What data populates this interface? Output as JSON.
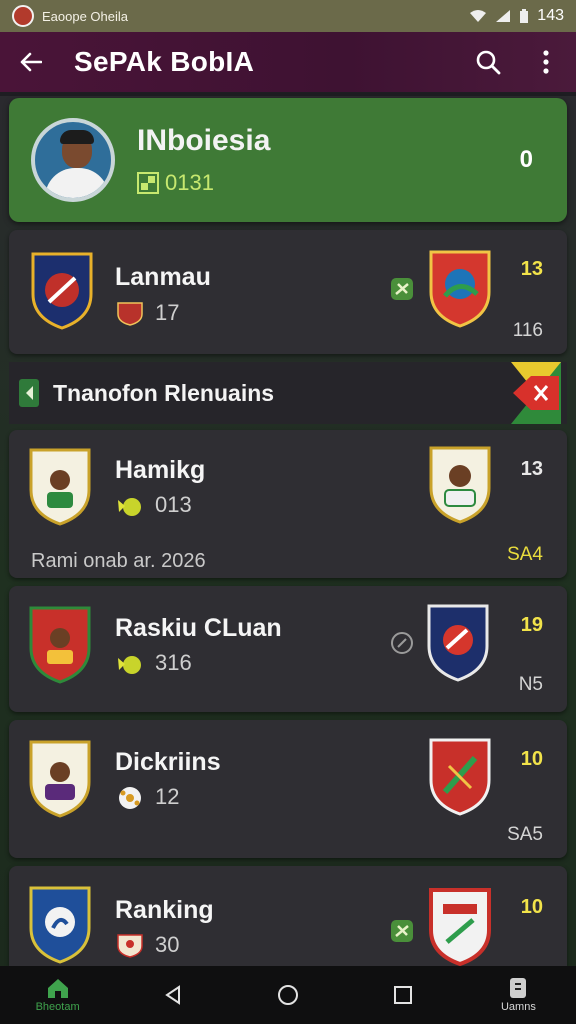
{
  "status_bar": {
    "app_name": "Eaoope Oheila",
    "time": "143"
  },
  "app_bar": {
    "title": "SePAk BobIA"
  },
  "feature": {
    "name": "INboiesia",
    "code": "0131",
    "score": "0"
  },
  "matches": [
    {
      "team": "Lanmau",
      "meta_value": "17",
      "score_top": "13",
      "score_bottom": "116"
    },
    {
      "team": "Hamikg",
      "meta_value": "013",
      "score_top": "13",
      "score_bottom": "SA4",
      "footnote": "Rami onab ar. 2026"
    },
    {
      "team": "Raskiu CLuan",
      "meta_value": "316",
      "score_top": "19",
      "score_bottom": "N5"
    },
    {
      "team": "Dickriins",
      "meta_value": "12",
      "score_top": "10",
      "score_bottom": "SA5"
    },
    {
      "team": "Ranking",
      "meta_value": "30",
      "score_top": "10"
    }
  ],
  "section": {
    "title": "Tnanofon Rlenuains"
  },
  "bottom_nav": {
    "left_label": "Bheotam",
    "right_label": "Uamns"
  },
  "colors": {
    "accent_green": "#3f7a36",
    "app_bar": "#4a1438",
    "score_yellow": "#f2e34a"
  }
}
